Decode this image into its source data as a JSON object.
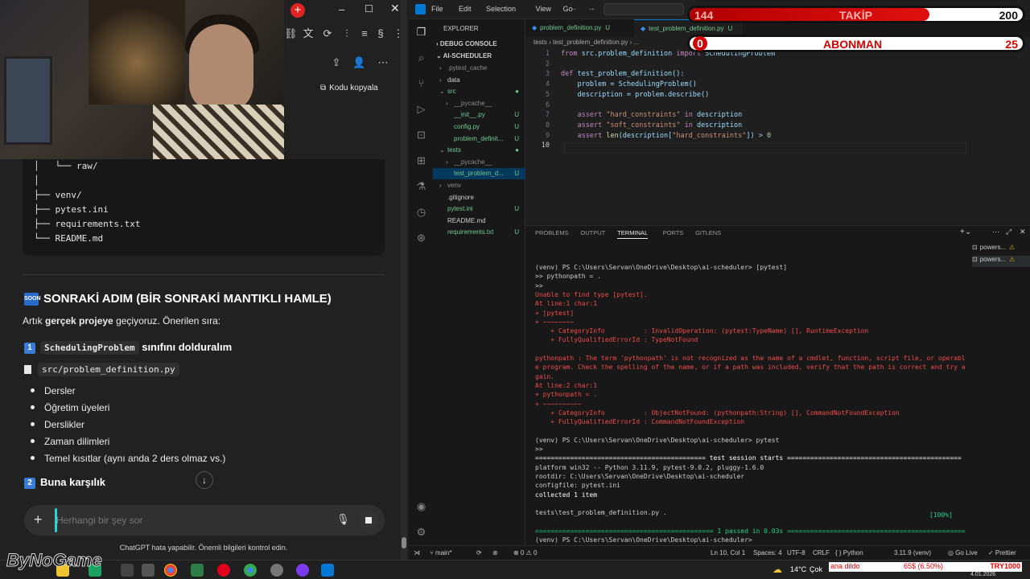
{
  "colors": {
    "accent_blue": "#0078d4",
    "git_untracked": "#73c991",
    "error_red": "#f14c4c",
    "overlay_red": "#d00000"
  },
  "chatgpt": {
    "copy_code": "Kodu kopyala",
    "tree": [
      "│   └── raw/",
      "│",
      "├── venv/",
      "├── pytest.ini",
      "├── requirements.txt",
      "└── README.md"
    ],
    "section_icon": "SOON",
    "section_title": "SONRAKİ ADIM (BİR SONRAKİ MANTIKLI HAMLE)",
    "intro_prefix": "Artık ",
    "intro_bold": "gerçek projeye",
    "intro_suffix": " geçiyoruz. Önerilen sıra:",
    "step1_num": "1",
    "step1_code": "SchedulingProblem",
    "step1_text": "sınıfını dolduralım",
    "file_path": "src/problem_definition.py",
    "bullets": [
      "Dersler",
      "Öğretim üyeleri",
      "Derslikler",
      "Zaman dilimleri",
      "Temel kısıtlar (aynı anda 2 ders olmaz vs.)"
    ],
    "step2_num": "2",
    "step2_text": "Buna karşılık",
    "input_placeholder": "Herhangi bir şey sor",
    "disclaimer": "ChatGPT hata yapabilir. Önemli bilgileri kontrol edin."
  },
  "vscode": {
    "menu": [
      "File",
      "Edit",
      "Selection",
      "View",
      "Go"
    ],
    "explorer_title": "EXPLORER",
    "debug_console": "DEBUG CONSOLE",
    "project": "AI-SCHEDULER",
    "files": [
      {
        "name": ".pytest_cache",
        "indent": 1,
        "arrow": "›",
        "color": "#8c8c8c",
        "git": ""
      },
      {
        "name": "data",
        "indent": 1,
        "arrow": "›",
        "color": "#cccccc",
        "git": ""
      },
      {
        "name": "src",
        "indent": 1,
        "arrow": "⌄",
        "color": "#73c991",
        "git": "●"
      },
      {
        "name": "__pycache__",
        "indent": 2,
        "arrow": "›",
        "color": "#8c8c8c",
        "git": ""
      },
      {
        "name": "__init__.py",
        "indent": 2,
        "arrow": "",
        "color": "#73c991",
        "git": "U"
      },
      {
        "name": "config.py",
        "indent": 2,
        "arrow": "",
        "color": "#73c991",
        "git": "U"
      },
      {
        "name": "problem_definit...",
        "indent": 2,
        "arrow": "",
        "color": "#73c991",
        "git": "U"
      },
      {
        "name": "tests",
        "indent": 1,
        "arrow": "⌄",
        "color": "#73c991",
        "git": "●"
      },
      {
        "name": "__pycache__",
        "indent": 2,
        "arrow": "›",
        "color": "#8c8c8c",
        "git": ""
      },
      {
        "name": "test_problem_d...",
        "indent": 2,
        "arrow": "",
        "color": "#73c991",
        "git": "U"
      },
      {
        "name": "venv",
        "indent": 1,
        "arrow": "›",
        "color": "#8c8c8c",
        "git": ""
      },
      {
        "name": ".gitignore",
        "indent": 1,
        "arrow": "",
        "color": "#cccccc",
        "git": ""
      },
      {
        "name": "pytest.ini",
        "indent": 1,
        "arrow": "",
        "color": "#73c991",
        "git": "U"
      },
      {
        "name": "README.md",
        "indent": 1,
        "arrow": "",
        "color": "#cccccc",
        "git": ""
      },
      {
        "name": "requirements.txt",
        "indent": 1,
        "arrow": "",
        "color": "#73c991",
        "git": "U"
      }
    ],
    "tabs": [
      {
        "name": "problem_definition.py",
        "git": "U",
        "active": false
      },
      {
        "name": "test_problem_definition.py",
        "git": "U",
        "active": true
      }
    ],
    "breadcrumb": "tests  ›  test_problem_definition.py  ›  ...",
    "code": [
      "from src.problem_definition import SchedulingProblem",
      "",
      "def test_problem_definition():",
      "    problem = SchedulingProblem()",
      "    description = problem.describe()",
      "",
      "    assert \"hard_constraints\" in description",
      "    assert \"soft_constraints\" in description",
      "    assert len(description[\"hard_constraints\"]) > 0",
      ""
    ],
    "panel_tabs": [
      "PROBLEMS",
      "OUTPUT",
      "TERMINAL",
      "PORTS",
      "GITLENS"
    ],
    "terminals": [
      "powers...",
      "powers..."
    ],
    "terminal": [
      {
        "t": "(venv) PS C:\\Users\\Servan\\OneDrive\\Desktop\\ai-scheduler> [pytest]",
        "c": "#cccccc"
      },
      {
        "t": ">> pythonpath = .",
        "c": "#cccccc"
      },
      {
        "t": ">>",
        "c": "#cccccc"
      },
      {
        "t": "Unable to find type [pytest].",
        "c": "#f14c4c"
      },
      {
        "t": "At line:1 char:1",
        "c": "#f14c4c"
      },
      {
        "t": "+ [pytest]",
        "c": "#f14c4c"
      },
      {
        "t": "+ ~~~~~~~~",
        "c": "#f14c4c"
      },
      {
        "t": "    + CategoryInfo          : InvalidOperation: (pytest:TypeName) [], RuntimeException",
        "c": "#f14c4c"
      },
      {
        "t": "    + FullyQualifiedErrorId : TypeNotFound",
        "c": "#f14c4c"
      },
      {
        "t": "",
        "c": "#f14c4c"
      },
      {
        "t": "pythonpath : The term 'pythonpath' is not recognized as the name of a cmdlet, function, script file, or operabl",
        "c": "#f14c4c"
      },
      {
        "t": "e program. Check the spelling of the name, or if a path was included, verify that the path is correct and try a",
        "c": "#f14c4c"
      },
      {
        "t": "gain.",
        "c": "#f14c4c"
      },
      {
        "t": "At line:2 char:1",
        "c": "#f14c4c"
      },
      {
        "t": "+ pythonpath = .",
        "c": "#f14c4c"
      },
      {
        "t": "+ ~~~~~~~~~~",
        "c": "#f14c4c"
      },
      {
        "t": "    + CategoryInfo          : ObjectNotFound: (pythonpath:String) [], CommandNotFoundException",
        "c": "#f14c4c"
      },
      {
        "t": "    + FullyQualifiedErrorId : CommandNotFoundException",
        "c": "#f14c4c"
      },
      {
        "t": "",
        "c": "#cccccc"
      },
      {
        "t": "(venv) PS C:\\Users\\Servan\\OneDrive\\Desktop\\ai-scheduler> pytest",
        "c": "#cccccc"
      },
      {
        "t": ">>",
        "c": "#cccccc"
      },
      {
        "t": "============================================ test session starts =============================================",
        "c": "#ffffff"
      },
      {
        "t": "platform win32 -- Python 3.11.9, pytest-9.0.2, pluggy-1.6.0",
        "c": "#cccccc"
      },
      {
        "t": "rootdir: C:\\Users\\Servan\\OneDrive\\Desktop\\ai-scheduler",
        "c": "#cccccc"
      },
      {
        "t": "configfile: pytest.ini",
        "c": "#cccccc"
      },
      {
        "t": "collected 1 item",
        "c": "#ffffff"
      },
      {
        "t": "",
        "c": "#cccccc"
      },
      {
        "t": "tests\\test_problem_definition.py .",
        "c": "#cccccc"
      },
      {
        "t": "",
        "c": "#cccccc"
      },
      {
        "t": "============================================== 1 passed in 0.03s ==============================================",
        "c": "#23d18b"
      },
      {
        "t": "(venv) PS C:\\Users\\Servan\\OneDrive\\Desktop\\ai-scheduler> ",
        "c": "#cccccc"
      }
    ],
    "percent": "[100%]",
    "status": {
      "branch": "main*",
      "problems": "⊗ 0 ⚠ 0",
      "position": "Ln 10, Col 1",
      "spaces": "Spaces: 4",
      "encoding": "UTF-8",
      "eol": "CRLF",
      "language": "{ } Python",
      "interpreter": "3.11.9 (venv)",
      "golive": "Go Live",
      "prettier": "✓ Prettier"
    }
  },
  "overlay": {
    "follow_current": "144",
    "follow_label": "TAKİP",
    "follow_goal": "200",
    "follow_progress": 0.72,
    "sub_current": "0",
    "sub_label": "ABONMAN",
    "sub_goal": "25",
    "sub_progress": 0.0
  },
  "taskbar": {
    "weather": "14°C",
    "weather_text": "Çok",
    "ticker1": "ana dildo",
    "ticker2": "65$ (6.50%)",
    "ticker3": "TRY1000",
    "date": "4.01.2026"
  },
  "watermark": "ByNoGame"
}
